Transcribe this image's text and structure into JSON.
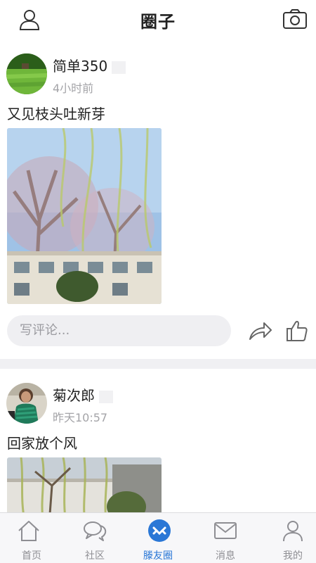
{
  "header": {
    "title": "圈子",
    "left_icon": "user-profile-icon",
    "right_icon": "camera-icon"
  },
  "posts": [
    {
      "author": "简单350",
      "time": "4小时前",
      "content": "又见枝头吐新芽",
      "comment_placeholder": "写评论...",
      "avatar_icon": "rice-field-avatar",
      "photo": "willow-tree-photo"
    },
    {
      "author": "菊次郎",
      "time": "昨天10:57",
      "content": "回家放个风",
      "photo": "willow-building-photo",
      "avatar_icon": "person-avatar"
    }
  ],
  "actions": {
    "share_icon": "share-icon",
    "like_icon": "thumbs-up-icon"
  },
  "tabbar": {
    "active_index": 2,
    "items": [
      {
        "label": "首页",
        "icon": "home-icon"
      },
      {
        "label": "社区",
        "icon": "chat-bubbles-icon"
      },
      {
        "label": "滕友圈",
        "icon": "friends-circle-icon"
      },
      {
        "label": "消息",
        "icon": "envelope-icon"
      },
      {
        "label": "我的",
        "icon": "user-icon"
      }
    ]
  },
  "colors": {
    "accent": "#2a77d6",
    "text": "#222222",
    "muted": "#a4a4a8",
    "input_bg": "#efeff2"
  }
}
